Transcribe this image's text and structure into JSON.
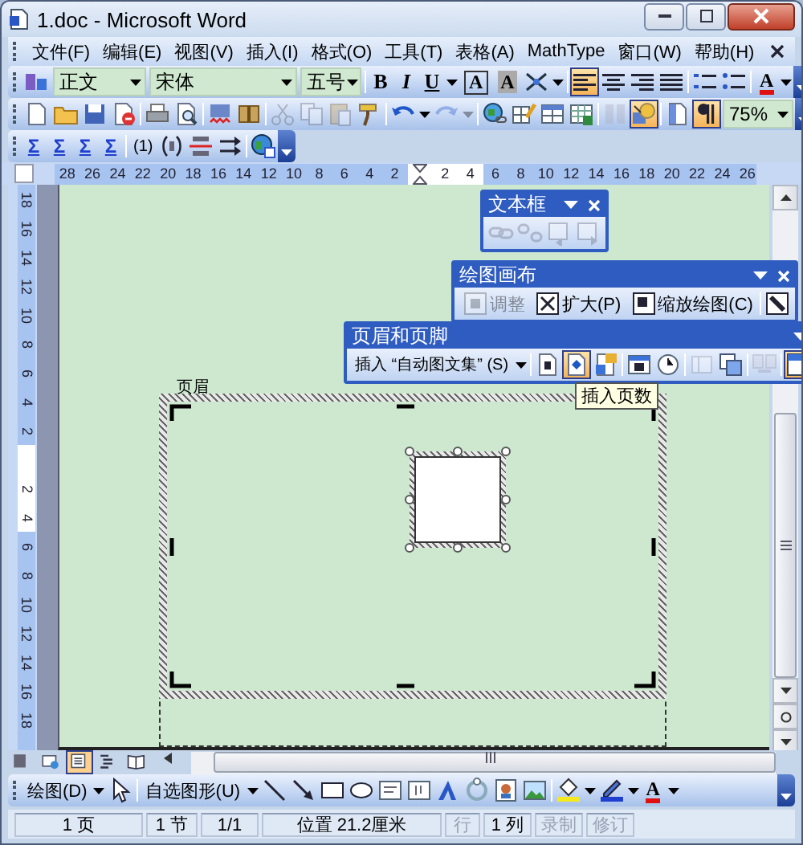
{
  "window": {
    "title": "1.doc - Microsoft Word"
  },
  "menu_bar": {
    "items": [
      "文件(F)",
      "编辑(E)",
      "视图(V)",
      "插入(I)",
      "格式(O)",
      "工具(T)",
      "表格(A)",
      "MathType",
      "窗口(W)",
      "帮助(H)"
    ]
  },
  "formatting_toolbar": {
    "groups": [
      [
        {
          "kind": "styles",
          "pressed": false,
          "disabled": false
        },
        {
          "kind": "style-combo",
          "value": "正文",
          "pressed": false,
          "disabled": false
        },
        {
          "kind": "font-combo",
          "value": "宋体",
          "pressed": false,
          "disabled": false
        },
        {
          "kind": "size-combo",
          "value": "五号",
          "pressed": false,
          "disabled": false
        }
      ],
      [
        {
          "kind": "bold",
          "label": "B",
          "pressed": false,
          "disabled": false
        },
        {
          "kind": "italic",
          "label": "I",
          "pressed": false,
          "disabled": false
        },
        {
          "kind": "underline",
          "label": "U",
          "pressed": false,
          "disabled": false
        },
        {
          "kind": "caret",
          "pressed": false,
          "disabled": false
        },
        {
          "kind": "boxed",
          "label": "A",
          "pressed": false,
          "disabled": false
        },
        {
          "kind": "shaded",
          "label": "A",
          "pressed": false,
          "disabled": false
        },
        {
          "kind": "scatter",
          "pressed": false,
          "disabled": false
        },
        {
          "kind": "caret",
          "pressed": false,
          "disabled": false
        }
      ],
      [
        {
          "kind": "align-left",
          "pressed": true,
          "disabled": false
        },
        {
          "kind": "align-center",
          "pressed": false,
          "disabled": false
        },
        {
          "kind": "align-right",
          "pressed": false,
          "disabled": false
        },
        {
          "kind": "distribute",
          "pressed": false,
          "disabled": false
        }
      ],
      [
        {
          "kind": "numbering",
          "pressed": false,
          "disabled": false
        },
        {
          "kind": "bullets",
          "pressed": false,
          "disabled": false
        }
      ],
      [
        {
          "kind": "font-color",
          "label": "A",
          "pressed": false,
          "disabled": false
        },
        {
          "kind": "caret",
          "pressed": false,
          "disabled": false
        }
      ]
    ]
  },
  "standard_toolbar": {
    "groups": [
      [
        {
          "kind": "new",
          "pressed": false,
          "disabled": false
        },
        {
          "kind": "open",
          "pressed": false,
          "disabled": false
        },
        {
          "kind": "save",
          "pressed": false,
          "disabled": false
        },
        {
          "kind": "permission",
          "pressed": false,
          "disabled": false
        }
      ],
      [
        {
          "kind": "print",
          "pressed": false,
          "disabled": false
        },
        {
          "kind": "preview",
          "pressed": false,
          "disabled": false
        }
      ],
      [
        {
          "kind": "spell",
          "pressed": false,
          "disabled": false
        },
        {
          "kind": "research",
          "pressed": false,
          "disabled": false
        }
      ],
      [
        {
          "kind": "cut",
          "pressed": false,
          "disabled": true
        },
        {
          "kind": "copy",
          "pressed": false,
          "disabled": true
        },
        {
          "kind": "paste",
          "pressed": false,
          "disabled": true
        },
        {
          "kind": "painter",
          "pressed": false,
          "disabled": false
        }
      ],
      [
        {
          "kind": "undo",
          "pressed": false,
          "disabled": false
        },
        {
          "kind": "caret",
          "pressed": false,
          "disabled": false
        },
        {
          "kind": "redo",
          "pressed": false,
          "disabled": true
        },
        {
          "kind": "caret",
          "pressed": false,
          "disabled": true
        }
      ],
      [
        {
          "kind": "hyperlink",
          "pressed": false,
          "disabled": false
        },
        {
          "kind": "tables",
          "pressed": false,
          "disabled": false
        },
        {
          "kind": "table",
          "pressed": false,
          "disabled": false
        },
        {
          "kind": "excel",
          "pressed": false,
          "disabled": false
        }
      ],
      [
        {
          "kind": "columns",
          "pressed": false,
          "disabled": true
        },
        {
          "kind": "drawing",
          "pressed": true,
          "disabled": false
        }
      ],
      [
        {
          "kind": "docmap",
          "pressed": false,
          "disabled": false
        },
        {
          "kind": "pilcrow",
          "pressed": true,
          "disabled": false
        },
        {
          "kind": "zoom-combo",
          "value": "75%",
          "pressed": false,
          "disabled": false
        }
      ]
    ]
  },
  "mathtype_toolbar": {
    "groups": [
      [
        {
          "kind": "sigma",
          "label": "Σ",
          "pressed": false,
          "disabled": false
        },
        {
          "kind": "sigma",
          "label": "Σ",
          "pressed": false,
          "disabled": false
        },
        {
          "kind": "sigma",
          "label": "Σ",
          "pressed": false,
          "disabled": false
        },
        {
          "kind": "sigma",
          "label": "Σ",
          "pressed": false,
          "disabled": false
        }
      ],
      [
        {
          "kind": "eqnum",
          "label": "(1)",
          "pressed": false,
          "disabled": false
        },
        {
          "kind": "eqref",
          "pressed": false,
          "disabled": false
        },
        {
          "kind": "eqbreak",
          "pressed": false,
          "disabled": false
        },
        {
          "kind": "equpdate",
          "pressed": false,
          "disabled": false
        }
      ],
      [
        {
          "kind": "globe",
          "pressed": false,
          "disabled": false
        }
      ]
    ]
  },
  "horizontal_ruler": {
    "before": [
      "28",
      "26",
      "24",
      "22",
      "20",
      "18",
      "16",
      "14",
      "12",
      "10",
      "8",
      "6",
      "4",
      "2"
    ],
    "inside": [
      "2",
      "4"
    ],
    "after": [
      "6",
      "8",
      "10",
      "12",
      "14",
      "16",
      "18",
      "20",
      "22",
      "24",
      "26"
    ]
  },
  "vertical_ruler": {
    "before": [
      "18",
      "16",
      "14",
      "12",
      "10",
      "8",
      "6",
      "4",
      "2"
    ],
    "inside": [
      "2",
      "4"
    ],
    "after": [
      "6",
      "8",
      "10",
      "12",
      "14",
      "16",
      "18"
    ]
  },
  "text_box_toolbar": {
    "title": "文本框",
    "close_button": true,
    "groups": [
      [
        {
          "kind": "link",
          "pressed": false,
          "disabled": true
        },
        {
          "kind": "unlink",
          "pressed": false,
          "disabled": true
        },
        {
          "kind": "prevbox",
          "pressed": false,
          "disabled": true
        },
        {
          "kind": "nextbox",
          "pressed": false,
          "disabled": true
        }
      ]
    ]
  },
  "canvas_toolbar": {
    "title": "绘图画布",
    "close_button": true,
    "groups": [
      [
        {
          "kind": "fit",
          "label": "调整",
          "pressed": false,
          "disabled": true
        },
        {
          "kind": "expand",
          "label": "扩大(P)",
          "pressed": false,
          "disabled": false
        },
        {
          "kind": "scale",
          "label": "缩放绘图(C)",
          "pressed": false,
          "disabled": false
        }
      ],
      [
        {
          "kind": "wrap",
          "pressed": false,
          "disabled": false
        }
      ]
    ]
  },
  "header_footer_toolbar": {
    "title": "页眉和页脚",
    "close_button": false,
    "tooltip": "插入页数",
    "groups": [
      [
        {
          "kind": "autotext",
          "label": "插入 “自动图文集” (S)",
          "pressed": false,
          "disabled": false
        },
        {
          "kind": "caret",
          "pressed": false,
          "disabled": false
        }
      ],
      [
        {
          "kind": "page-number",
          "pressed": false,
          "disabled": false
        },
        {
          "kind": "page-count",
          "pressed": true,
          "disabled": false
        },
        {
          "kind": "format-number",
          "pressed": false,
          "disabled": false
        }
      ],
      [
        {
          "kind": "date",
          "pressed": false,
          "disabled": false
        },
        {
          "kind": "time",
          "pressed": false,
          "disabled": false
        }
      ],
      [
        {
          "kind": "page-setup",
          "pressed": false,
          "disabled": true
        },
        {
          "kind": "show-text",
          "pressed": false,
          "disabled": false
        }
      ],
      [
        {
          "kind": "same-prev",
          "pressed": false,
          "disabled": true
        }
      ],
      [
        {
          "kind": "switch",
          "pressed": true,
          "disabled": false
        }
      ]
    ]
  },
  "document": {
    "header_label": "页眉"
  },
  "view_buttons": [
    {
      "kind": "normal",
      "selected": false
    },
    {
      "kind": "web",
      "selected": false
    },
    {
      "kind": "layout",
      "selected": true
    },
    {
      "kind": "outline",
      "selected": false
    },
    {
      "kind": "reading",
      "selected": false
    }
  ],
  "drawing_toolbar": {
    "groups": [
      [
        {
          "kind": "menu",
          "label": "绘图(D)",
          "pressed": false,
          "disabled": false
        },
        {
          "kind": "caret",
          "pressed": false,
          "disabled": false
        },
        {
          "kind": "pointer",
          "pressed": false,
          "disabled": false
        }
      ],
      [
        {
          "kind": "menu",
          "label": "自选图形(U)",
          "pressed": false,
          "disabled": false
        },
        {
          "kind": "caret",
          "pressed": false,
          "disabled": false
        },
        {
          "kind": "line",
          "pressed": false,
          "disabled": false
        },
        {
          "kind": "arrow",
          "pressed": false,
          "disabled": false
        },
        {
          "kind": "rect",
          "pressed": false,
          "disabled": false
        },
        {
          "kind": "oval",
          "pressed": false,
          "disabled": false
        },
        {
          "kind": "textbox",
          "pressed": false,
          "disabled": false
        },
        {
          "kind": "vtextbox",
          "pressed": false,
          "disabled": false
        },
        {
          "kind": "wordart",
          "pressed": false,
          "disabled": false
        },
        {
          "kind": "diagram",
          "pressed": false,
          "disabled": false
        },
        {
          "kind": "clipart",
          "pressed": false,
          "disabled": false
        },
        {
          "kind": "picture",
          "pressed": false,
          "disabled": false
        }
      ],
      [
        {
          "kind": "fill-color",
          "pressed": false,
          "disabled": false
        },
        {
          "kind": "caret",
          "pressed": false,
          "disabled": false
        },
        {
          "kind": "line-color",
          "pressed": false,
          "disabled": false
        },
        {
          "kind": "caret",
          "pressed": false,
          "disabled": false
        },
        {
          "kind": "font-color",
          "label": "A",
          "pressed": false,
          "disabled": false
        },
        {
          "kind": "caret",
          "pressed": false,
          "disabled": false
        }
      ]
    ]
  },
  "status_bar": {
    "items": [
      {
        "text": "1 页",
        "disabled": false
      },
      {
        "text": "1 节",
        "disabled": false
      },
      {
        "text": "1/1",
        "disabled": false
      },
      {
        "text": "位置 21.2厘米",
        "disabled": false
      },
      {
        "text": "行",
        "disabled": true
      },
      {
        "text": "1 列",
        "disabled": false
      },
      {
        "text": "录制",
        "disabled": true
      },
      {
        "text": "修订",
        "disabled": true
      }
    ]
  }
}
